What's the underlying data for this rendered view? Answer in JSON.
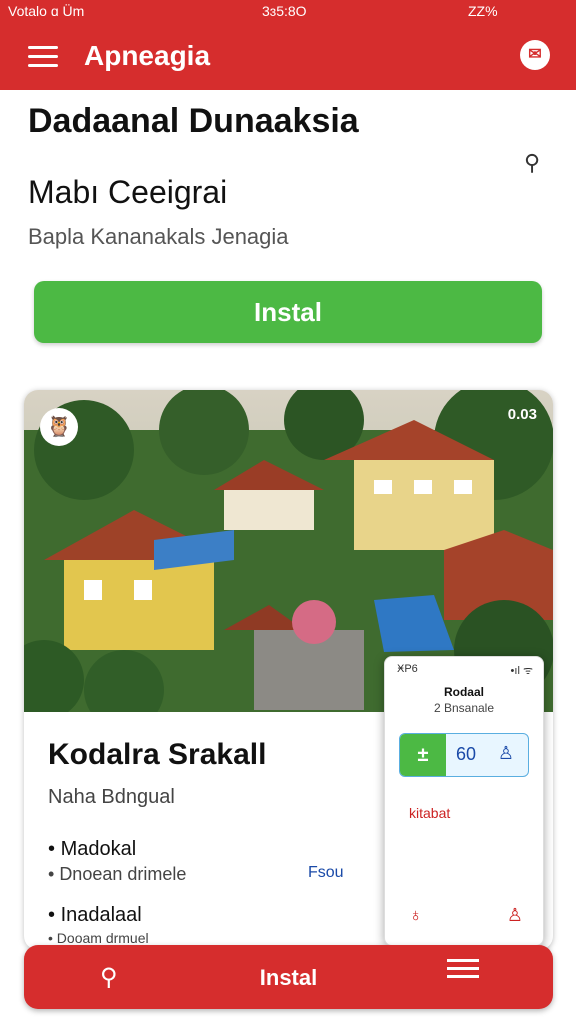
{
  "status": {
    "left": "Votalo ɑ Üm",
    "time": "3ɜ5:8O",
    "battery": "ZZ%"
  },
  "appbar": {
    "title": "Apneagia"
  },
  "header": {
    "title": "Dadaanal Dunaaksia",
    "subtitle": "Mabı Ceeigrai",
    "caption": "Bapla Kananakals Jenagia"
  },
  "install_button": "Instal",
  "card": {
    "counter": "0.03",
    "title": "Kodalra Srakall",
    "subtitle": "Naha Bdngual",
    "features": [
      "Madokal",
      "Dnoean drimele",
      "Inadalaal",
      "Dooam drmuel"
    ],
    "link": "Fsou"
  },
  "phone": {
    "status_left": "ӾP6",
    "status_right": "•ıl ᯤ",
    "title": "Rodaal",
    "subtitle": "2 Bnsanale",
    "number": "60",
    "label": "kitabat"
  },
  "bottom": {
    "label": "Instal"
  },
  "colors": {
    "primary": "#d62d2d",
    "accent": "#4cb944"
  }
}
